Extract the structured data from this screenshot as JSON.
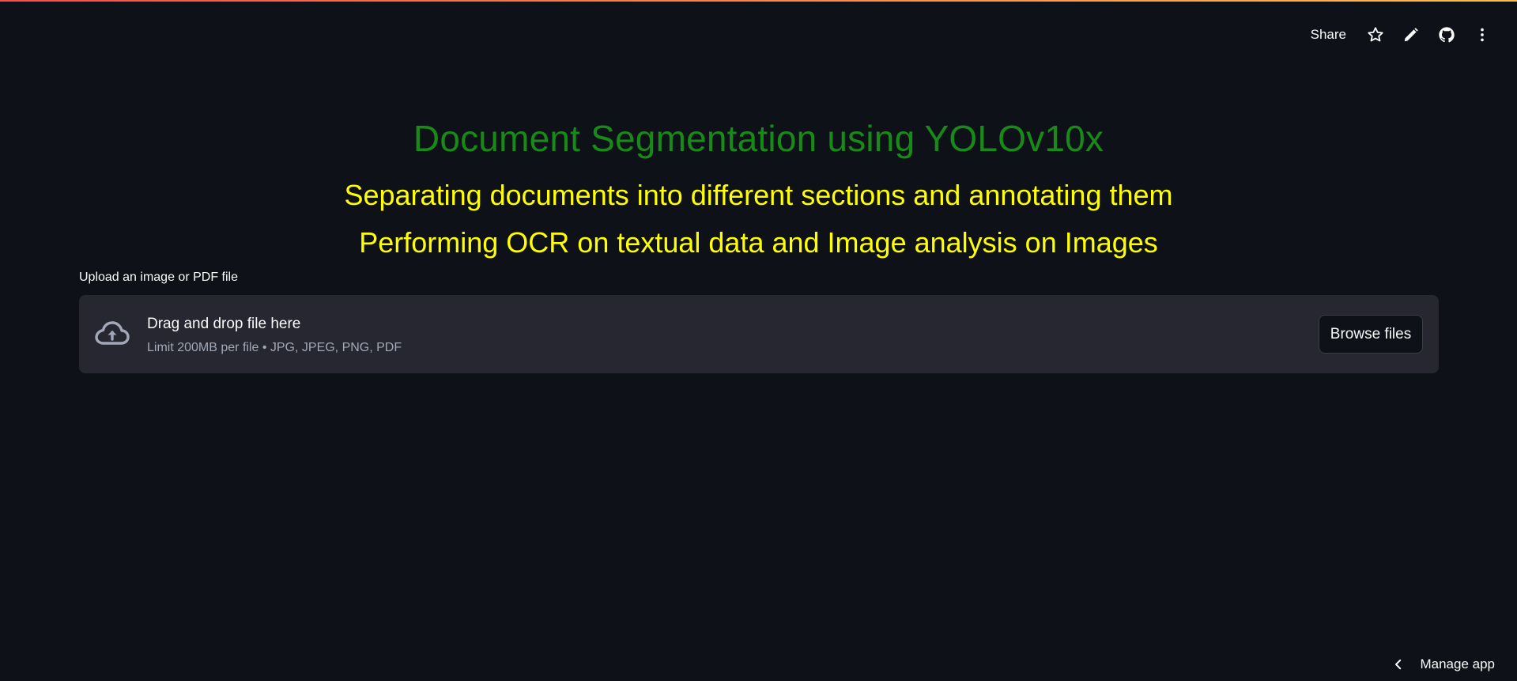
{
  "header": {
    "share_label": "Share",
    "icons": [
      "star-icon",
      "pencil-icon",
      "github-icon",
      "more-vertical-icon"
    ]
  },
  "main": {
    "title": "Document Segmentation using YOLOv10x",
    "subtitle_1": "Separating documents into different sections and annotating them",
    "subtitle_2": "Performing OCR on textual data and Image analysis on Images"
  },
  "uploader": {
    "label": "Upload an image or PDF file",
    "drop_title": "Drag and drop file here",
    "drop_limit": "Limit 200MB per file • JPG, JPEG, PNG, PDF",
    "browse_label": "Browse files"
  },
  "footer": {
    "manage_app_label": "Manage app"
  },
  "colors": {
    "background": "#0e1117",
    "title": "#188a18",
    "subtitles": "#ffff00",
    "dropzone": "#262730"
  }
}
